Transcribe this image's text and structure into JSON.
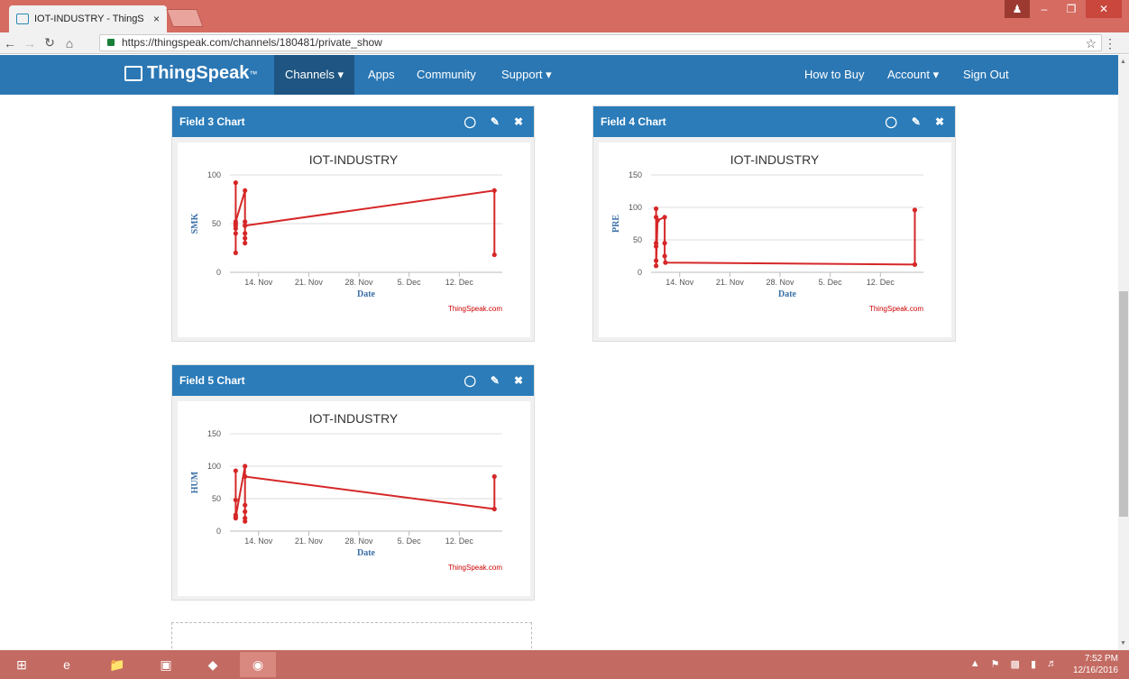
{
  "browser": {
    "tab_title": "IOT-INDUSTRY - ThingS ",
    "tab_close": "×",
    "url": "https://thingspeak.com/channels/180481/private_show"
  },
  "nav": {
    "logo": "ThingSpeak",
    "logo_tm": "™",
    "items": [
      {
        "label": "Channels ▾",
        "active": true
      },
      {
        "label": "Apps"
      },
      {
        "label": "Community"
      },
      {
        "label": "Support ▾"
      },
      {
        "label": "How to Buy"
      },
      {
        "label": "Account ▾"
      },
      {
        "label": "Sign Out"
      }
    ]
  },
  "panels": [
    {
      "title": "Field 3 Chart"
    },
    {
      "title": "Field 4 Chart"
    },
    {
      "title": "Field 5 Chart"
    }
  ],
  "credit": "ThingSpeak.com",
  "chart_data": [
    {
      "type": "line",
      "title": "IOT-INDUSTRY",
      "xlabel": "Date",
      "ylabel": "SMK",
      "ylim": [
        0,
        100
      ],
      "yticks": [
        "0",
        "50",
        "100"
      ],
      "xticks": [
        "14. Nov",
        "21. Nov",
        "28. Nov",
        "5. Dec",
        "12. Dec"
      ],
      "color": "#d62728",
      "series": [
        {
          "x": [
            10.8,
            10.8,
            10.8,
            10.8,
            10.8,
            10.8,
            10.8,
            12.1,
            12.1,
            12.1,
            12.1,
            12.1,
            12.1,
            12.1,
            46.9,
            46.9
          ],
          "values": [
            92,
            48,
            40,
            20,
            50,
            45,
            52,
            84,
            30,
            48,
            52,
            40,
            35,
            48,
            84,
            18
          ]
        }
      ]
    },
    {
      "type": "line",
      "title": "IOT-INDUSTRY",
      "xlabel": "Date",
      "ylabel": "PRE",
      "ylim": [
        0,
        150
      ],
      "yticks": [
        "0",
        "50",
        "100",
        "150"
      ],
      "xticks": [
        "14. Nov",
        "21. Nov",
        "28. Nov",
        "5. Dec",
        "12. Dec"
      ],
      "color": "#d62728",
      "series": [
        {
          "x": [
            10.7,
            10.7,
            10.7,
            10.7,
            10.7,
            10.7,
            10.9,
            11.9,
            11.9,
            11.9,
            12.0,
            46.8,
            46.8
          ],
          "values": [
            98,
            85,
            45,
            40,
            18,
            10,
            80,
            85,
            45,
            25,
            15,
            12,
            96
          ]
        }
      ]
    },
    {
      "type": "line",
      "title": "IOT-INDUSTRY",
      "xlabel": "Date",
      "ylabel": "HUM",
      "ylim": [
        0,
        150
      ],
      "yticks": [
        "0",
        "50",
        "100",
        "150"
      ],
      "xticks": [
        "14. Nov",
        "21. Nov",
        "28. Nov",
        "5. Dec",
        "12. Dec"
      ],
      "color": "#d62728",
      "series": [
        {
          "x": [
            10.8,
            10.8,
            10.8,
            10.8,
            10.8,
            12.1,
            12.1,
            12.1,
            12.1,
            12.1,
            12.1,
            46.9,
            46.9
          ],
          "values": [
            93,
            48,
            25,
            20,
            22,
            100,
            20,
            15,
            30,
            40,
            84,
            34,
            84
          ]
        }
      ]
    }
  ],
  "taskbar": {
    "time": "7:52 PM",
    "date": "12/16/2016"
  }
}
